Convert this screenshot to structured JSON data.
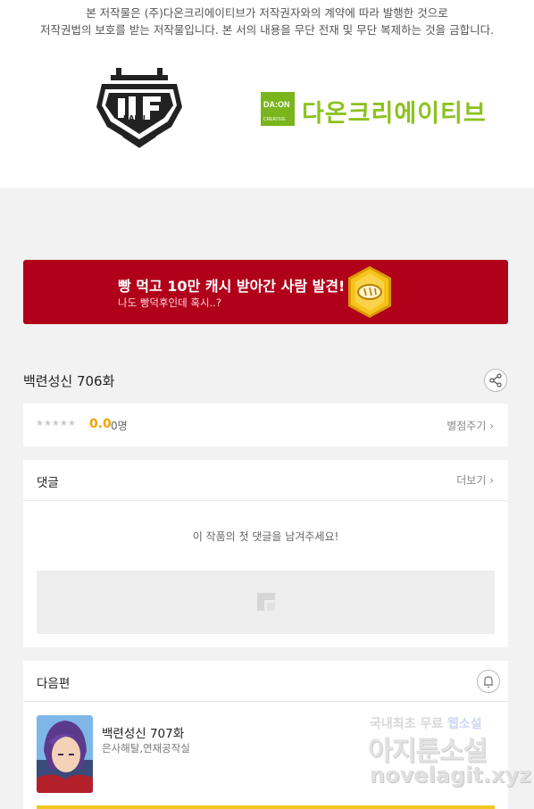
{
  "copyright": {
    "line1": "본 저작물은 (주)다온크리에이티브가 저작권자와의 계약에 따라 발행한 것으로",
    "line2": "저작권법의 보호를 받는 저작물입니다. 본 서의 내용을 무단 전재 및 무단 복제하는 것을 금합니다."
  },
  "logos": {
    "left_logo_text": "RAKU",
    "daon_box_text": "DA:ON",
    "daon_box_sub": "CREATIVE",
    "daon_name": "다온크리에이티브",
    "brand_green": "#8cc21f"
  },
  "banner": {
    "title": "빵 먹고 10만 캐시 받아간 사람 발견!",
    "subtitle": "나도 빵덕후인데 혹시..?",
    "bg_color": "#b0001a",
    "icon": "bread-coin-icon"
  },
  "episode": {
    "title": "백련성신 706화",
    "share_icon": "share-icon"
  },
  "rating": {
    "stars": "★★★★★",
    "score": "0.0",
    "count": "0명",
    "rate_link": "별점주기 ›",
    "score_color": "#f5a300"
  },
  "comments": {
    "header": "댓글",
    "more": "더보기 ›",
    "empty_text": "이 작품의 첫 댓글을 남겨주세요!"
  },
  "next": {
    "header": "다음편",
    "bell_icon": "bell-icon",
    "title": "백련성신 707화",
    "subtitle": "은사해탈,연재공작실"
  },
  "watermark": {
    "line1_a": "국내최초 무료",
    "line1_b": "웹소설",
    "line2": "아지툰소설",
    "line3": "novelagit.xyz"
  }
}
